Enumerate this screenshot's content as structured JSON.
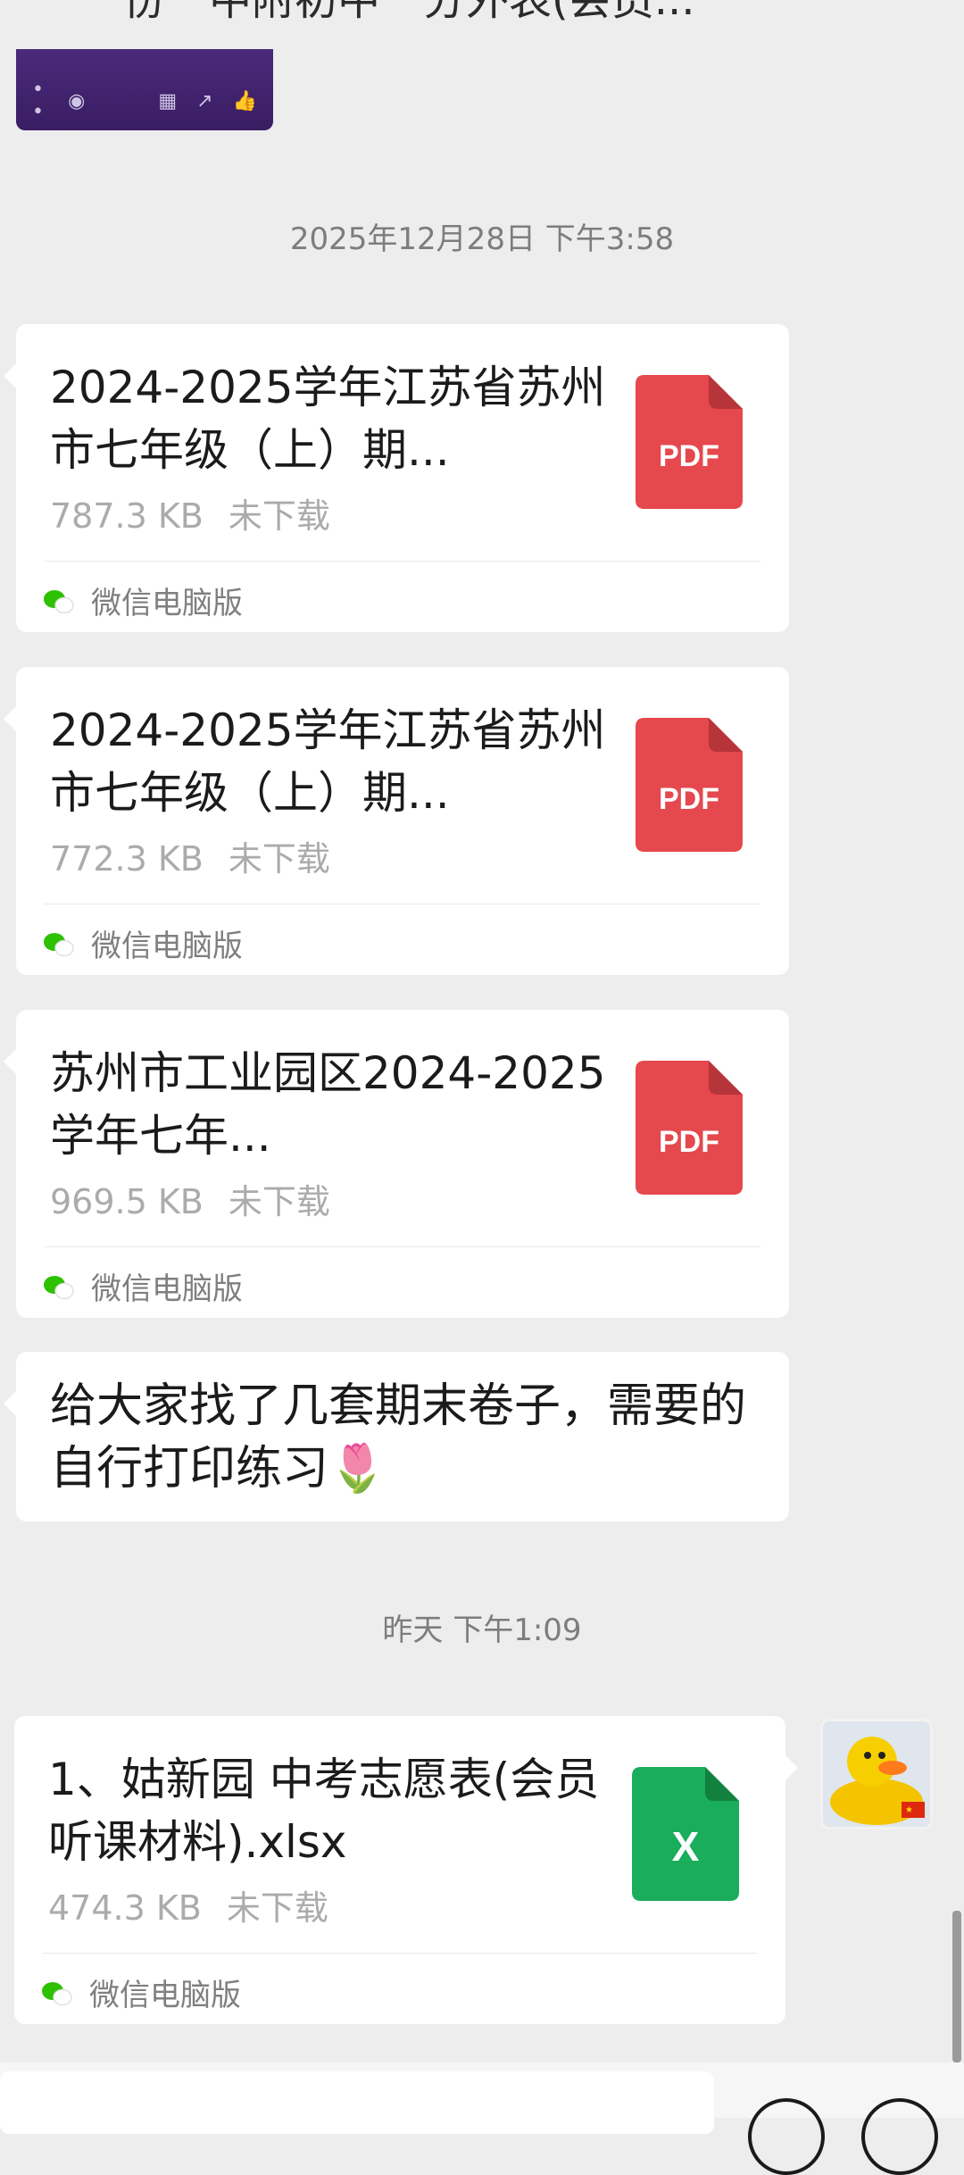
{
  "top_partial_text": "一份一中附初中一分外表(会员...",
  "timestamps": {
    "first": "2025年12月28日 下午3:58",
    "second": "昨天 下午1:09"
  },
  "messages": [
    {
      "title": "2024-2025学年江苏省苏州市七年级（上）期...",
      "size": "787.3 KB",
      "status": "未下载",
      "icon_label": "PDF",
      "source": "微信电脑版"
    },
    {
      "title": "2024-2025学年江苏省苏州市七年级（上）期...",
      "size": "772.3 KB",
      "status": "未下载",
      "icon_label": "PDF",
      "source": "微信电脑版"
    },
    {
      "title": "苏州市工业园区2024-2025学年七年...",
      "size": "969.5 KB",
      "status": "未下载",
      "icon_label": "PDF",
      "source": "微信电脑版"
    }
  ],
  "text_message": {
    "text": "给大家找了几套期末卷子，需要的自行打印练习🌷"
  },
  "my_file": {
    "title": "1、姑新园 中考志愿表(会员听课材料).xlsx",
    "size": "474.3 KB",
    "status": "未下载",
    "icon_label": "X",
    "source": "微信电脑版"
  },
  "colors": {
    "pdf_red": "#e5484d",
    "excel_green": "#1aad5b",
    "wechat_green": "#2dc100",
    "background": "#ededed"
  }
}
